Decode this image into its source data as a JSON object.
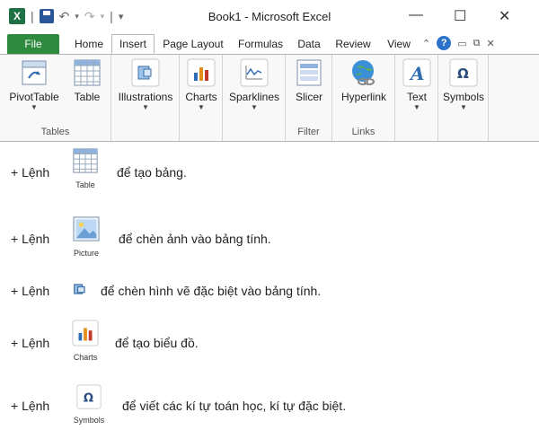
{
  "window": {
    "title": "Book1  -  Microsoft Excel",
    "qat_separator": "|",
    "controls": [
      "—",
      "☐",
      "✕"
    ]
  },
  "tabs": [
    {
      "label": "File"
    },
    {
      "label": "Home"
    },
    {
      "label": "Insert"
    },
    {
      "label": "Page Layout"
    },
    {
      "label": "Formulas"
    },
    {
      "label": "Data"
    },
    {
      "label": "Review"
    },
    {
      "label": "View"
    }
  ],
  "ribbon": {
    "commands": {
      "pivottable": "PivotTable",
      "table": "Table",
      "illustrations": "Illustrations",
      "charts": "Charts",
      "sparklines": "Sparklines",
      "slicer": "Slicer",
      "hyperlink": "Hyperlink",
      "text": "Text",
      "symbols": "Symbols"
    },
    "groups": {
      "tables": "Tables",
      "filter": "Filter",
      "links": "Links"
    }
  },
  "items": [
    {
      "prefix": "+ Lệnh",
      "icon_label": "Table",
      "text": "để tạo bảng."
    },
    {
      "prefix": "+ Lệnh",
      "icon_label": "Picture",
      "text": "để chèn ảnh vào bảng tính."
    },
    {
      "prefix": "+ Lệnh",
      "icon_label": "",
      "text": "để chèn hình vẽ đặc biệt vào bảng tính."
    },
    {
      "prefix": "+ Lệnh",
      "icon_label": "Charts",
      "text": "để tạo biểu đồ."
    },
    {
      "prefix": "+ Lệnh",
      "icon_label": "Symbols",
      "text": "để viết các kí tự toán học, kí tự đặc biệt."
    }
  ],
  "colors": {
    "file_tab": "#2d8a3e",
    "excel_green": "#1e7145",
    "help_blue": "#2b73c9"
  },
  "icons": {
    "symbol_glyph": "Ω",
    "text_glyph": "A"
  }
}
